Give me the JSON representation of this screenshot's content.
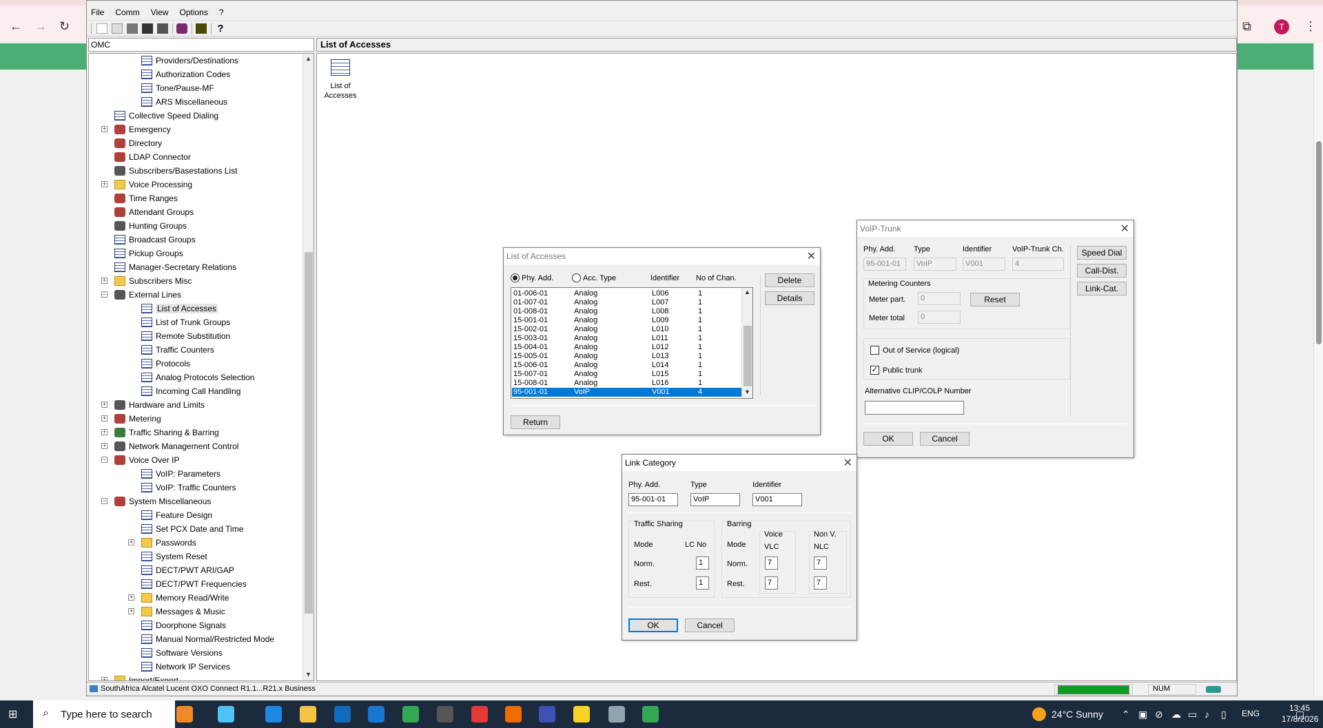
{
  "browser": {
    "back_icon": "←",
    "forward_icon": "→",
    "reload_icon": "↻",
    "profile_initial": "T",
    "extensions_icon": "⧉",
    "menu_icon": "⋮"
  },
  "app": {
    "menu": [
      "File",
      "Comm",
      "View",
      "Options",
      "?"
    ],
    "left_header": "OMC",
    "right_header": "List of Accesses",
    "tree": [
      {
        "label": "Providers/Destinations",
        "icon": "list",
        "level": 3
      },
      {
        "label": "Authorization Codes",
        "icon": "list",
        "level": 3
      },
      {
        "label": "Tone/Pause-MF",
        "icon": "list",
        "level": 3
      },
      {
        "label": "ARS Miscellaneous",
        "icon": "list",
        "level": 3
      },
      {
        "label": "Collective Speed Dialing",
        "icon": "list",
        "level": 2
      },
      {
        "label": "Emergency",
        "icon": "gen",
        "level": 2,
        "expander": "+"
      },
      {
        "label": "Directory",
        "icon": "gen",
        "level": 2
      },
      {
        "label": "LDAP Connector",
        "icon": "gen",
        "level": 2
      },
      {
        "label": "Subscribers/Basestations List",
        "icon": "gen3",
        "level": 2
      },
      {
        "label": "Voice Processing",
        "icon": "fold",
        "level": 2,
        "expander": "+"
      },
      {
        "label": "Time Ranges",
        "icon": "gen",
        "level": 2
      },
      {
        "label": "Attendant Groups",
        "icon": "gen",
        "level": 2
      },
      {
        "label": "Hunting Groups",
        "icon": "gen3",
        "level": 2
      },
      {
        "label": "Broadcast Groups",
        "icon": "list",
        "level": 2
      },
      {
        "label": "Pickup Groups",
        "icon": "list",
        "level": 2
      },
      {
        "label": "Manager-Secretary Relations",
        "icon": "list",
        "level": 2
      },
      {
        "label": "Subscribers Misc",
        "icon": "fold",
        "level": 2,
        "expander": "+"
      },
      {
        "label": "External Lines",
        "icon": "gen3",
        "level": 2,
        "expander": "−"
      },
      {
        "label": "List of Accesses",
        "icon": "list",
        "level": 3,
        "selected": true
      },
      {
        "label": "List of Trunk Groups",
        "icon": "list",
        "level": 3
      },
      {
        "label": "Remote Substitution",
        "icon": "list",
        "level": 3
      },
      {
        "label": "Traffic Counters",
        "icon": "list",
        "level": 3
      },
      {
        "label": "Protocols",
        "icon": "list",
        "level": 3
      },
      {
        "label": "Analog Protocols Selection",
        "icon": "list",
        "level": 3
      },
      {
        "label": "Incoming Call Handling",
        "icon": "list",
        "level": 3
      },
      {
        "label": "Hardware and Limits",
        "icon": "gen3",
        "level": 2,
        "expander": "+"
      },
      {
        "label": "Metering",
        "icon": "gen",
        "level": 2,
        "expander": "+"
      },
      {
        "label": "Traffic Sharing & Barring",
        "icon": "gen2",
        "level": 2,
        "expander": "+"
      },
      {
        "label": "Network Management Control",
        "icon": "gen3",
        "level": 2,
        "expander": "+"
      },
      {
        "label": "Voice Over IP",
        "icon": "gen",
        "level": 2,
        "expander": "−"
      },
      {
        "label": "VoIP: Parameters",
        "icon": "list",
        "level": 3
      },
      {
        "label": "VoIP: Traffic Counters",
        "icon": "list",
        "level": 3
      },
      {
        "label": "System Miscellaneous",
        "icon": "gen",
        "level": 2,
        "expander": "−"
      },
      {
        "label": "Feature Design",
        "icon": "list",
        "level": 3
      },
      {
        "label": "Set PCX Date and Time",
        "icon": "list",
        "level": 3
      },
      {
        "label": "Passwords",
        "icon": "fold",
        "level": 3,
        "expander": "+"
      },
      {
        "label": "System Reset",
        "icon": "list",
        "level": 3
      },
      {
        "label": "DECT/PWT ARI/GAP",
        "icon": "list",
        "level": 3
      },
      {
        "label": "DECT/PWT Frequencies",
        "icon": "list",
        "level": 3
      },
      {
        "label": "Memory Read/Write",
        "icon": "fold",
        "level": 3,
        "expander": "+"
      },
      {
        "label": "Messages & Music",
        "icon": "fold",
        "level": 3,
        "expander": "+"
      },
      {
        "label": "Doorphone Signals",
        "icon": "list",
        "level": 3
      },
      {
        "label": "Manual Normal/Restricted Mode",
        "icon": "list",
        "level": 3
      },
      {
        "label": "Software Versions",
        "icon": "list",
        "level": 3
      },
      {
        "label": "Network IP Services",
        "icon": "list",
        "level": 3
      },
      {
        "label": "Import/Export",
        "icon": "fold",
        "level": 2,
        "expander": "+"
      }
    ],
    "content_icon_label": "List of Accesses",
    "status": {
      "text": "SouthAfrica Alcatel Lucent OXO Connect R1.1...R21.x Business",
      "num": "NUM"
    }
  },
  "accesses_dialog": {
    "title": "List of Accesses",
    "radio_phy": "Phy. Add.",
    "radio_acc": "Acc. Type",
    "col_identifier": "Identifier",
    "col_chan": "No of Chan.",
    "rows": [
      [
        "01-006-01",
        "Analog",
        "L006",
        "1"
      ],
      [
        "01-007-01",
        "Analog",
        "L007",
        "1"
      ],
      [
        "01-008-01",
        "Analog",
        "L008",
        "1"
      ],
      [
        "15-001-01",
        "Analog",
        "L009",
        "1"
      ],
      [
        "15-002-01",
        "Analog",
        "L010",
        "1"
      ],
      [
        "15-003-01",
        "Analog",
        "L011",
        "1"
      ],
      [
        "15-004-01",
        "Analog",
        "L012",
        "1"
      ],
      [
        "15-005-01",
        "Analog",
        "L013",
        "1"
      ],
      [
        "15-006-01",
        "Analog",
        "L014",
        "1"
      ],
      [
        "15-007-01",
        "Analog",
        "L015",
        "1"
      ],
      [
        "15-008-01",
        "Analog",
        "L016",
        "1"
      ],
      [
        "95-001-01",
        "VoIP",
        "V001",
        "4"
      ]
    ],
    "delete": "Delete",
    "details": "Details",
    "return": "Return"
  },
  "voip_dialog": {
    "title": "VoIP-Trunk",
    "phy_label": "Phy. Add.",
    "phy_value": "95-001-01",
    "type_label": "Type",
    "type_value": "VoIP",
    "id_label": "Identifier",
    "id_value": "V001",
    "ch_label": "VoIP-Trunk Ch.",
    "ch_value": "4",
    "metering_label": "Metering Counters",
    "meter_part_label": "Meter part.",
    "meter_part_value": "0",
    "meter_total_label": "Meter total",
    "meter_total_value": "0",
    "reset": "Reset",
    "out_of_service": "Out of Service (logical)",
    "public_trunk": "Public trunk",
    "clip_label": "Alternative CLIP/COLP Number",
    "clip_value": "",
    "speed_dial": "Speed Dial",
    "call_dist": "Call-Dist.",
    "link_cat": "Link-Cat.",
    "ok": "OK",
    "cancel": "Cancel"
  },
  "link_dialog": {
    "title": "Link Category",
    "phy_label": "Phy. Add.",
    "phy_value": "95-001-01",
    "type_label": "Type",
    "type_value": "VoIP",
    "id_label": "Identifier",
    "id_value": "V001",
    "traffic_label": "Traffic Sharing",
    "mode": "Mode",
    "lcno": "LC No",
    "norm": "Norm.",
    "rest": "Rest.",
    "ts_norm": "1",
    "ts_rest": "1",
    "barring_label": "Barring",
    "voice": "Voice",
    "vlc": "VLC",
    "nonv": "Non V.",
    "nlc": "NLC",
    "vlc_norm": "7",
    "vlc_rest": "7",
    "nlc_norm": "7",
    "nlc_rest": "7",
    "ok": "OK",
    "cancel": "Cancel"
  },
  "taskbar": {
    "search_placeholder": "Type here to search",
    "search_icon": "⌕",
    "weather": "24°C  Sunny",
    "lang": "ENG",
    "time": "13:45",
    "date": "17/8/2026",
    "app_colors": [
      "#f08a24",
      "#4fc3f7",
      "#1e88e5",
      "#f6c445",
      "#0f6cbd",
      "#1976d2",
      "#34a853",
      "#555555",
      "#e53935",
      "#ef6c00",
      "#3f51b5",
      "#f9d423",
      "#90a4ae",
      "#34a853"
    ]
  }
}
